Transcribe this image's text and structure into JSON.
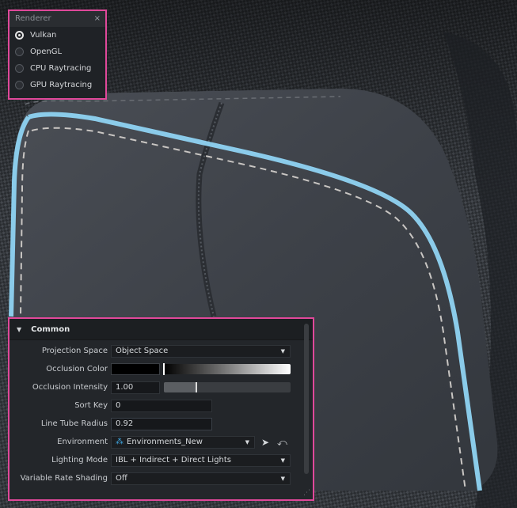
{
  "renderer": {
    "title": "Renderer",
    "close_glyph": "×",
    "options": [
      {
        "label": "Vulkan",
        "selected": true
      },
      {
        "label": "OpenGL",
        "selected": false
      },
      {
        "label": "CPU Raytracing",
        "selected": false
      },
      {
        "label": "GPU Raytracing",
        "selected": false
      }
    ]
  },
  "common": {
    "section_title": "Common",
    "projection_space": {
      "label": "Projection Space",
      "value": "Object Space"
    },
    "occlusion_color": {
      "label": "Occlusion Color",
      "swatch": "#000000",
      "gradient_position": 0.0
    },
    "occlusion_intensity": {
      "label": "Occlusion Intensity",
      "value": "1.00",
      "slider_fraction": 0.25
    },
    "sort_key": {
      "label": "Sort Key",
      "value": "0"
    },
    "line_tube_radius": {
      "label": "Line Tube Radius",
      "value": "0.92"
    },
    "environment": {
      "label": "Environment",
      "value": "Environments_New",
      "icon": "environment-icon"
    },
    "lighting_mode": {
      "label": "Lighting Mode",
      "value": "IBL + Indirect + Direct Lights"
    },
    "variable_rate_shading": {
      "label": "Variable Rate Shading",
      "value": "Off"
    }
  },
  "colors": {
    "highlight_border": "#e0489a",
    "accent_glow": "#8fd3f2"
  }
}
